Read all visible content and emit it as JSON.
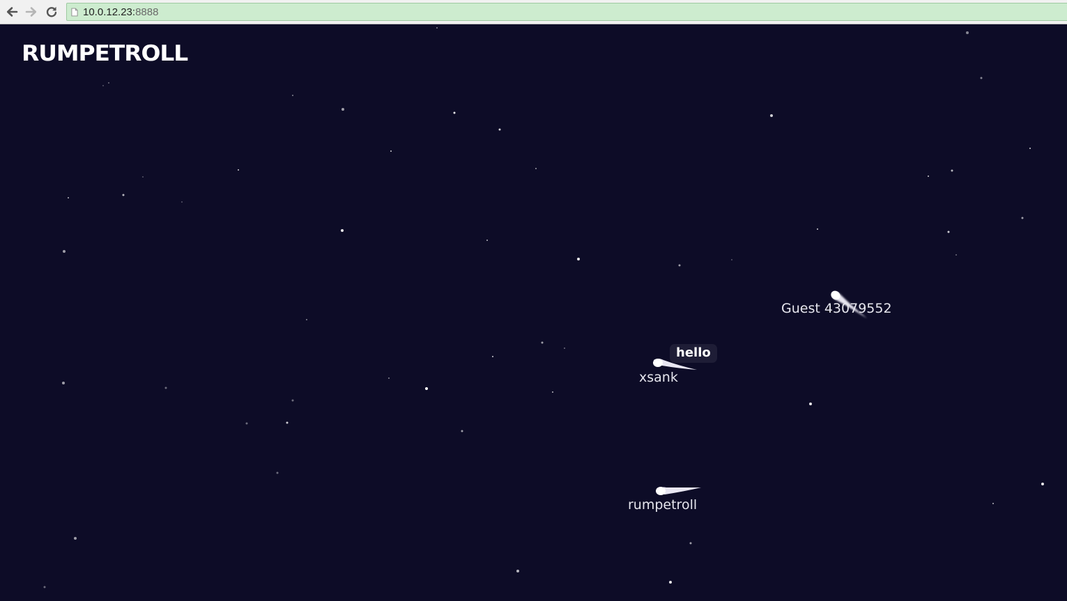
{
  "browser": {
    "url_host": "10.0.12.23:",
    "url_port": "8888",
    "back_icon": "arrow-left-icon",
    "forward_icon": "arrow-right-icon",
    "reload_icon": "reload-icon",
    "page_icon": "document-icon"
  },
  "game": {
    "logo": "RUMPETROLL",
    "background_color": "#0d0c27",
    "trolls": [
      {
        "name": "Guest 43079552",
        "message": ""
      },
      {
        "name": "xsank",
        "message": "hello"
      },
      {
        "name": "rumpetroll",
        "message": ""
      }
    ]
  }
}
